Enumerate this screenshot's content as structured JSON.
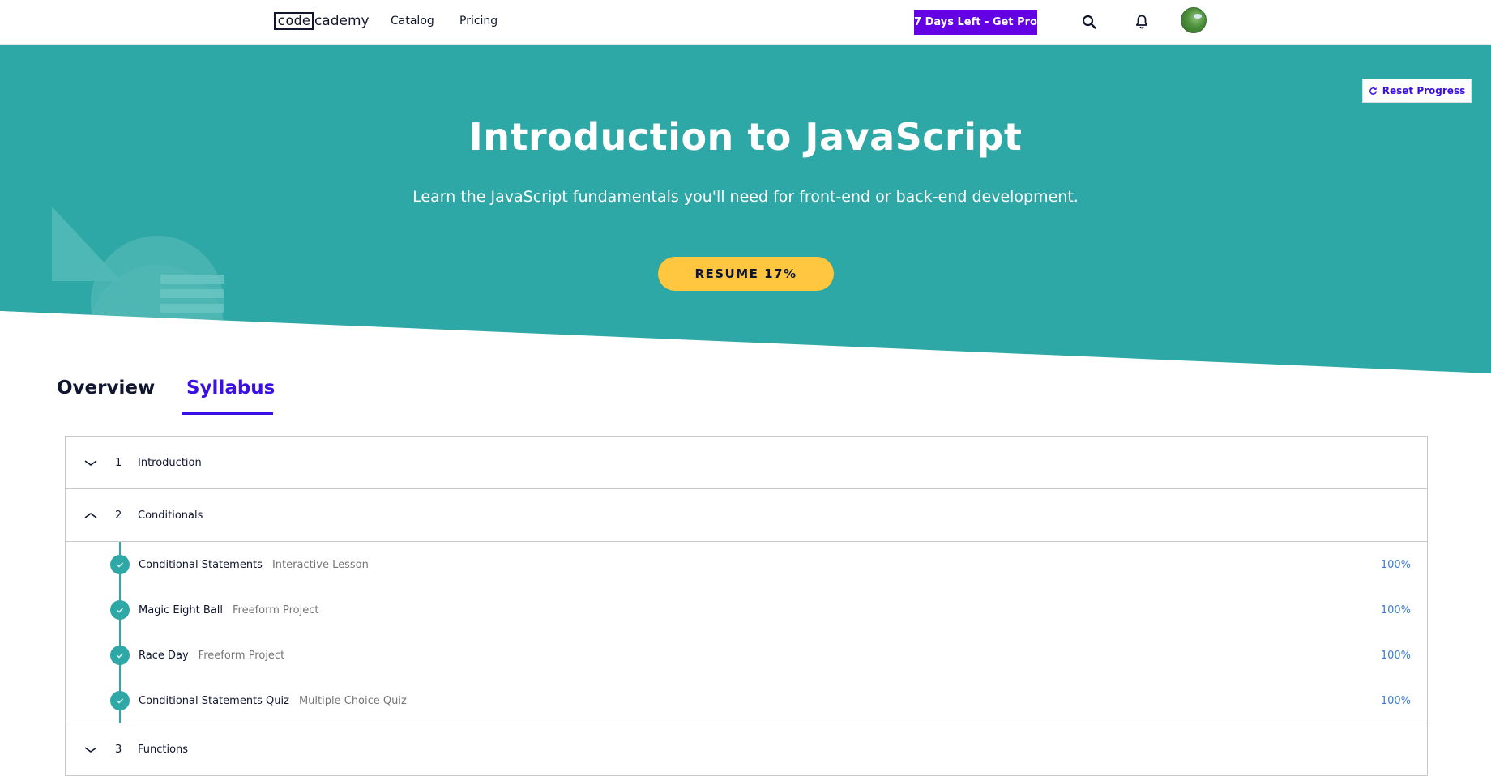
{
  "header": {
    "logo_code": "code",
    "logo_rest": "cademy",
    "nav": [
      {
        "label": "Catalog"
      },
      {
        "label": "Pricing"
      }
    ],
    "pro_button": "7 Days Left - Get Pro",
    "icons": {
      "search": "search-icon",
      "notifications": "bell-icon",
      "avatar": "avatar"
    }
  },
  "hero": {
    "title": "Introduction to JavaScript",
    "subtitle": "Learn the JavaScript fundamentals you'll need for front-end or back-end development.",
    "resume_button": "RESUME 17%",
    "reset_button": "Reset Progress",
    "colors": {
      "teal": "#2da8a6",
      "accent_yellow": "#ffc740",
      "brand_purple": "#3a10e5"
    }
  },
  "tabs": [
    {
      "label": "Overview",
      "active": false
    },
    {
      "label": "Syllabus",
      "active": true
    }
  ],
  "syllabus": {
    "modules": [
      {
        "number": "1",
        "title": "Introduction",
        "expanded": false
      },
      {
        "number": "2",
        "title": "Conditionals",
        "expanded": true,
        "lessons": [
          {
            "name": "Conditional Statements",
            "type": "Interactive Lesson",
            "progress": "100%"
          },
          {
            "name": "Magic Eight Ball",
            "type": "Freeform Project",
            "progress": "100%"
          },
          {
            "name": "Race Day",
            "type": "Freeform Project",
            "progress": "100%"
          },
          {
            "name": "Conditional Statements Quiz",
            "type": "Multiple Choice Quiz",
            "progress": "100%"
          }
        ]
      },
      {
        "number": "3",
        "title": "Functions",
        "expanded": false
      }
    ]
  }
}
